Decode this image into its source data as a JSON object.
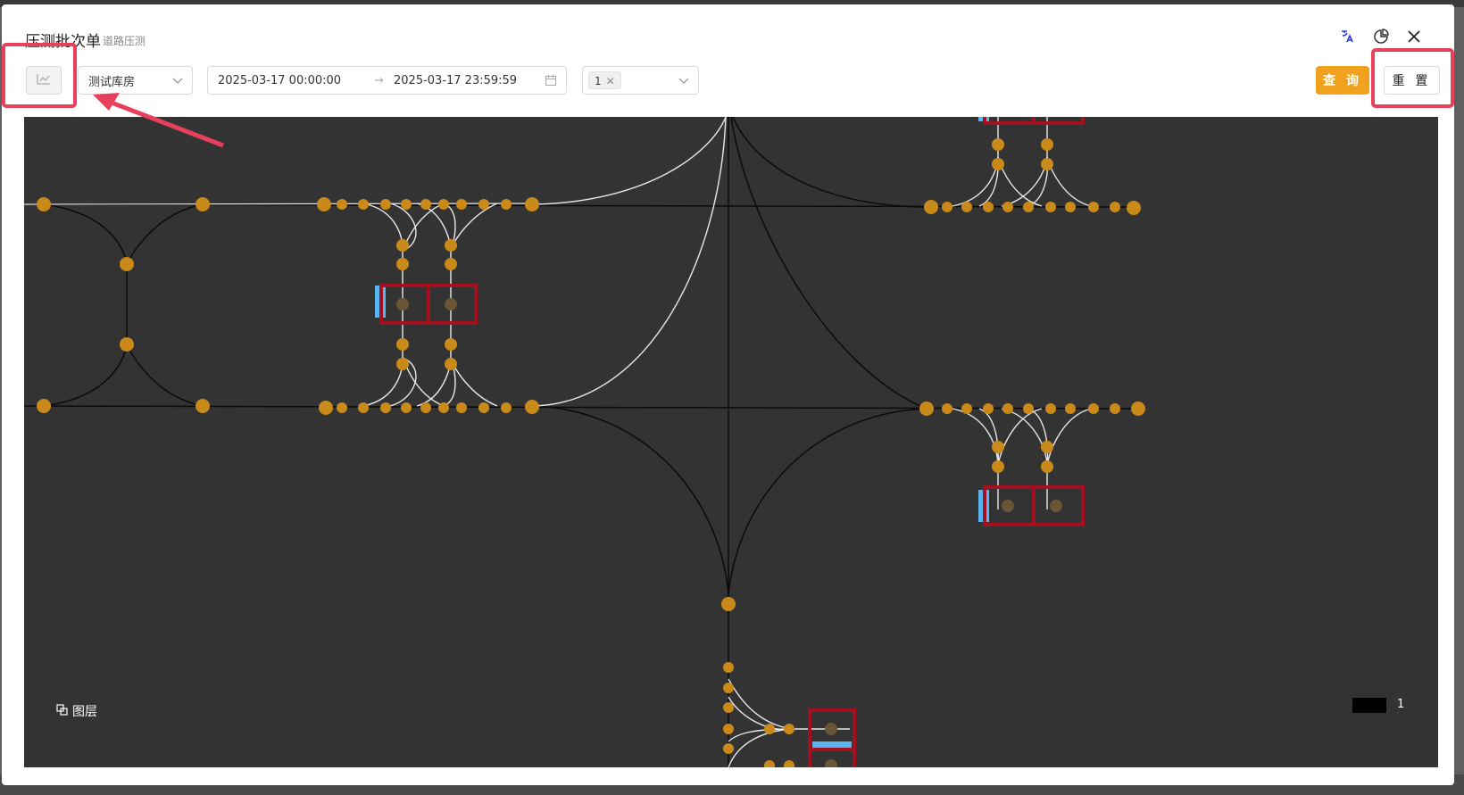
{
  "modal": {
    "title": "压测批次单",
    "subtitle": "道路压测"
  },
  "toolbar": {
    "warehouse_value": "测试库房",
    "date_start": "2025-03-17 00:00:00",
    "date_end": "2025-03-17 23:59:59",
    "range_separator": "→",
    "tag_value": "1",
    "query_label": "查 询",
    "reset_label": "重 置"
  },
  "map": {
    "layer_label": "图层",
    "legend_label": "1",
    "legend_color": "#000000",
    "background_color": "#333333",
    "node_color": "#c98a1a",
    "station_border_color": "#a5101e",
    "charger_color": "#5ab4f0"
  },
  "icons": {
    "header": [
      "translate-icon",
      "pie-chart-icon",
      "close-icon"
    ],
    "toolbar": "chart-toggle-icon",
    "layer": "layers-icon"
  },
  "colors": {
    "primary": "#f0a21e",
    "annotation": "#e8405a"
  }
}
